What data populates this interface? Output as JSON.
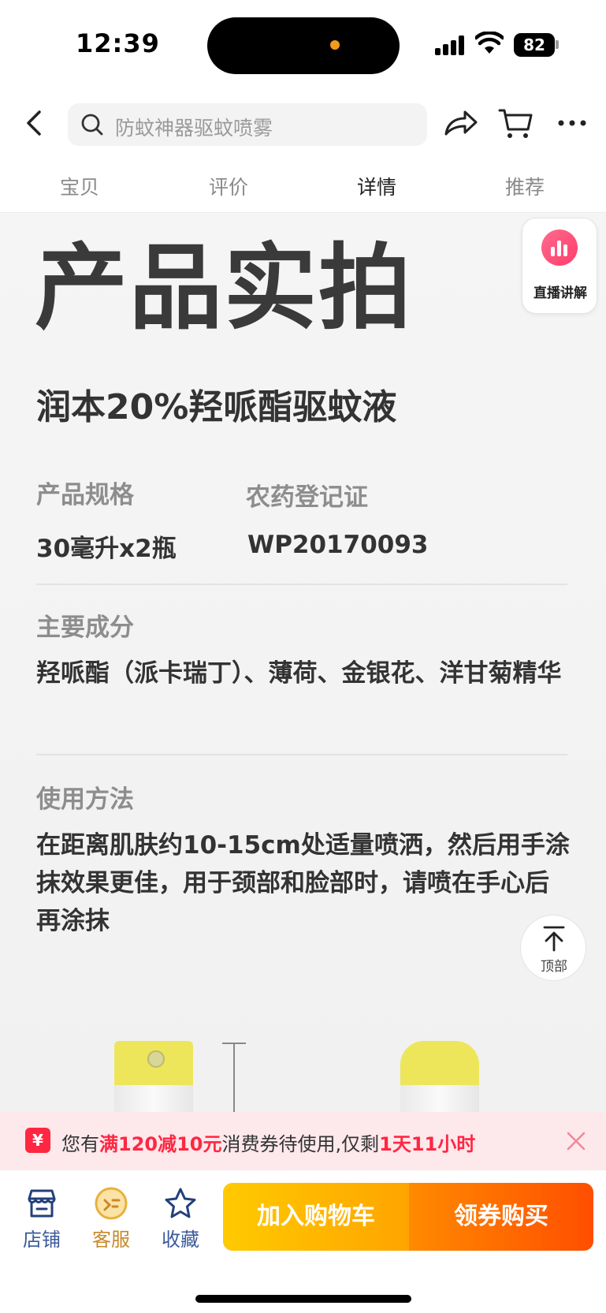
{
  "status_bar": {
    "time": "12:39",
    "battery": "82"
  },
  "search": {
    "placeholder": "防蚊神器驱蚊喷雾"
  },
  "tabs": [
    {
      "label": "宝贝",
      "active": false
    },
    {
      "label": "评价",
      "active": false
    },
    {
      "label": "详情",
      "active": true
    },
    {
      "label": "推荐",
      "active": false
    }
  ],
  "detail": {
    "title": "产品实拍",
    "product_name": "润本20%羟哌酯驱蚊液",
    "spec_label": "产品规格",
    "spec_value": "30毫升x2瓶",
    "reg_label": "农药登记证",
    "reg_value": "WP20170093",
    "ingredients_label": "主要成分",
    "ingredients_text": "羟哌酯（派卡瑞丁）、薄荷、金银花、洋甘菊精华",
    "usage_label": "使用方法",
    "usage_text": "在距离肌肤约10-15cm处适量喷洒，然后用手涂抹效果更佳，用于颈部和脸部时，请喷在手心后再涂抹"
  },
  "live": {
    "label": "直播讲解"
  },
  "back_to_top": {
    "label": "顶部"
  },
  "coupon": {
    "icon": "¥",
    "prefix": "您有",
    "highlight1": "满120减10元",
    "middle": "消费券待使用,仅剩",
    "highlight2": "1天11小时"
  },
  "bottom_bar": {
    "shop_label": "店铺",
    "service_label": "客服",
    "favorite_label": "收藏",
    "add_cart_label": "加入购物车",
    "buy_label": "领券购买"
  },
  "colors": {
    "accent_red": "#ff2741",
    "cart_yellow": "#ffca00",
    "buy_orange": "#ff4e00",
    "live_pink": "#ff3d6a"
  }
}
